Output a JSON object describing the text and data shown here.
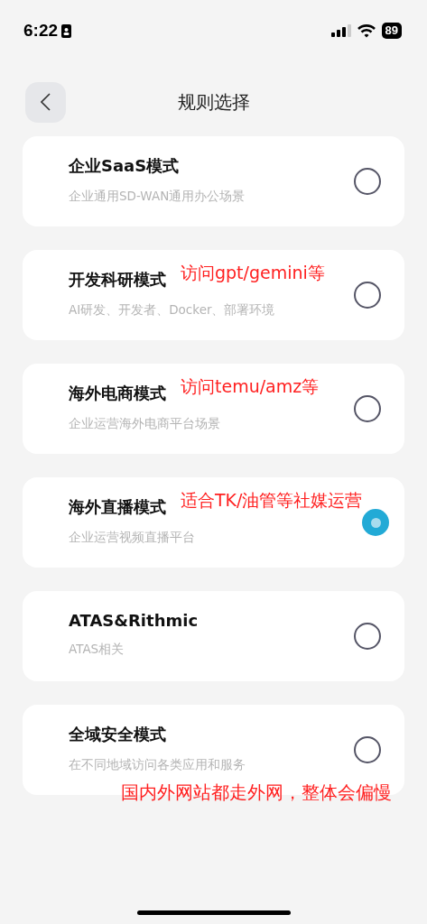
{
  "status_bar": {
    "time": "6:22",
    "battery": "89"
  },
  "header": {
    "title": "规则选择"
  },
  "rules": [
    {
      "name": "企业SaaS模式",
      "description": "企业通用SD-WAN通用办公场景",
      "selected": false
    },
    {
      "name": "开发科研模式",
      "description": "AI研发、开发者、Docker、部署环境",
      "selected": false,
      "note": "访问gpt/gemini等"
    },
    {
      "name": "海外电商模式",
      "description": "企业运营海外电商平台场景",
      "selected": false,
      "note": "访问temu/amz等"
    },
    {
      "name": "海外直播模式",
      "description": "企业运营视频直播平台",
      "selected": true,
      "note": "适合TK/油管等社媒运营"
    },
    {
      "name": "ATAS&Rithmic",
      "description": "ATAS相关",
      "selected": false
    },
    {
      "name": "全域安全模式",
      "description": "在不同地域访问各类应用和服务",
      "selected": false
    }
  ],
  "footer_note": "国内外网站都走外网，整体会偏慢"
}
